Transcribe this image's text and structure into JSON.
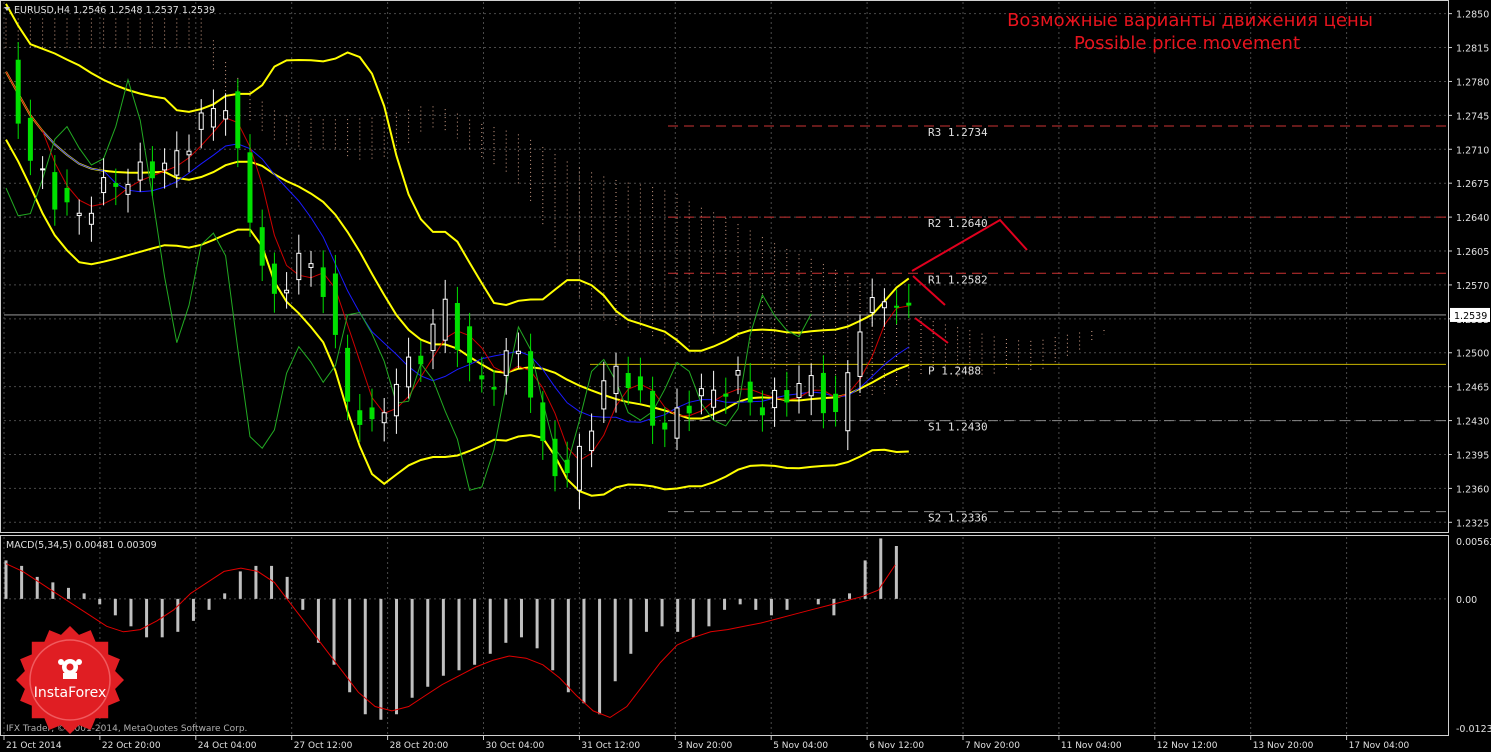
{
  "header": {
    "symbol_line": "EURUSD,H4  1.2546 1.2548 1.2537 1.2539",
    "annotation_ru": "Возможные варианты движения цены",
    "annotation_en": "Possible price movement"
  },
  "colors": {
    "background": "#000000",
    "grid": "#4a4a4a",
    "bullish": "#ffffff",
    "bearish": "#00e000",
    "bollinger": "#ffff00",
    "tenkan": "#cc0000",
    "kijun": "#1a1aff",
    "chikou": "#22aa22",
    "cloud": "#d4a28a",
    "pivot_res": "#cc3333",
    "pivot_p": "#c8b400",
    "pivot_sup": "#888888",
    "arrows": "#e0001e",
    "macd_hist": "#c0c0c0",
    "macd_signal": "#e00000",
    "annotation": "#e8141e",
    "logo": "#e01e23"
  },
  "price_axis": {
    "labels": [
      "1.2850",
      "1.2815",
      "1.2780",
      "1.2745",
      "1.2710",
      "1.2675",
      "1.2640",
      "1.2605",
      "1.2570",
      "1.2535",
      "1.2500",
      "1.2465",
      "1.2430",
      "1.2395",
      "1.2360",
      "1.2325"
    ],
    "current_price": "1.2539"
  },
  "time_axis": {
    "labels": [
      "21 Oct 2014",
      "22 Oct 20:00",
      "24 Oct 04:00",
      "27 Oct 12:00",
      "28 Oct 20:00",
      "30 Oct 04:00",
      "31 Oct 12:00",
      "3 Nov 20:00",
      "5 Nov 04:00",
      "6 Nov 12:00",
      "7 Nov 20:00",
      "11 Nov 04:00",
      "12 Nov 12:00",
      "13 Nov 20:00",
      "17 Nov 04:00"
    ]
  },
  "pivots": [
    {
      "name": "R3",
      "value": 1.2734,
      "label": "R3  1.2734",
      "kind": "res"
    },
    {
      "name": "R2",
      "value": 1.264,
      "label": "R2  1.2640",
      "kind": "res"
    },
    {
      "name": "R1",
      "value": 1.2582,
      "label": "R1  1.2582",
      "kind": "res"
    },
    {
      "name": "P",
      "value": 1.2488,
      "label": "P  1.2488",
      "kind": "p"
    },
    {
      "name": "S1",
      "value": 1.243,
      "label": "S1  1.2430",
      "kind": "sup"
    },
    {
      "name": "S2",
      "value": 1.2336,
      "label": "S2  1.2336",
      "kind": "sup"
    }
  ],
  "macd": {
    "label": "MACD(5,34,5) 0.00481 0.00309",
    "axis_labels": [
      "0.00563",
      "0.00",
      "-0.0123"
    ]
  },
  "footer": {
    "copyright": "IFX Trader, © 2001-2014, MetaQuotes Software Corp."
  },
  "logo": {
    "text": "InstaForex"
  },
  "chart_data": {
    "type": "candlestick",
    "symbol": "EURUSD",
    "timeframe": "H4",
    "ohlc": {
      "open": 1.2546,
      "high": 1.2548,
      "low": 1.2537,
      "close": 1.2539
    },
    "ylim": [
      1.2315,
      1.2862
    ],
    "macd_ylim": [
      -0.0123,
      0.00563
    ],
    "price_path": [
      [
        0,
        1.279
      ],
      [
        2,
        1.27
      ],
      [
        4,
        1.266
      ],
      [
        6,
        1.264
      ],
      [
        8,
        1.267
      ],
      [
        10,
        1.268
      ],
      [
        12,
        1.269
      ],
      [
        14,
        1.27
      ],
      [
        16,
        1.274
      ],
      [
        18,
        1.276
      ],
      [
        19,
        1.27
      ],
      [
        20,
        1.264
      ],
      [
        22,
        1.255
      ],
      [
        24,
        1.26
      ],
      [
        26,
        1.257
      ],
      [
        28,
        1.245
      ],
      [
        30,
        1.242
      ],
      [
        32,
        1.247
      ],
      [
        34,
        1.25
      ],
      [
        36,
        1.255
      ],
      [
        38,
        1.248
      ],
      [
        40,
        1.247
      ],
      [
        42,
        1.251
      ],
      [
        44,
        1.24
      ],
      [
        46,
        1.237
      ],
      [
        48,
        1.243
      ],
      [
        50,
        1.249
      ],
      [
        52,
        1.245
      ],
      [
        54,
        1.242
      ],
      [
        56,
        1.245
      ],
      [
        58,
        1.246
      ],
      [
        60,
        1.247
      ],
      [
        62,
        1.244
      ],
      [
        64,
        1.246
      ],
      [
        66,
        1.247
      ],
      [
        68,
        1.243
      ],
      [
        70,
        1.253
      ],
      [
        72,
        1.256
      ],
      [
        74,
        1.2539
      ]
    ],
    "macd_hist": [
      0.0035,
      0.003,
      0.002,
      0.0015,
      0.001,
      0.0005,
      -0.0005,
      -0.0015,
      -0.0025,
      -0.0035,
      -0.0035,
      -0.003,
      -0.002,
      -0.001,
      0.0005,
      0.0025,
      0.003,
      0.003,
      0.002,
      -0.001,
      -0.004,
      -0.006,
      -0.0085,
      -0.0105,
      -0.011,
      -0.0105,
      -0.009,
      -0.008,
      -0.007,
      -0.0065,
      -0.006,
      -0.005,
      -0.004,
      -0.0035,
      -0.0045,
      -0.0065,
      -0.0085,
      -0.0095,
      -0.0105,
      -0.0075,
      -0.005,
      -0.003,
      -0.0025,
      -0.003,
      -0.0035,
      -0.0025,
      -0.001,
      -0.0005,
      -0.001,
      -0.0015,
      -0.001,
      0.0,
      -0.0005,
      -0.0015,
      0.0005,
      0.0035,
      0.0055,
      0.00481
    ],
    "macd_signal": [
      0.0032,
      0.0025,
      0.0015,
      0.0005,
      -0.0005,
      -0.0015,
      -0.0025,
      -0.003,
      -0.0028,
      -0.002,
      -0.001,
      0.0005,
      0.0015,
      0.0025,
      0.0028,
      0.0025,
      0.0015,
      -0.0005,
      -0.0025,
      -0.0045,
      -0.0065,
      -0.0085,
      -0.0098,
      -0.0102,
      -0.0098,
      -0.0088,
      -0.0078,
      -0.007,
      -0.0062,
      -0.0056,
      -0.0052,
      -0.0054,
      -0.006,
      -0.0072,
      -0.0088,
      -0.0102,
      -0.0108,
      -0.0098,
      -0.0078,
      -0.0058,
      -0.0042,
      -0.0035,
      -0.003,
      -0.0028,
      -0.0025,
      -0.0022,
      -0.0018,
      -0.0014,
      -0.001,
      -0.0006,
      -0.0002,
      0.0002,
      0.0008,
      0.00309
    ]
  }
}
